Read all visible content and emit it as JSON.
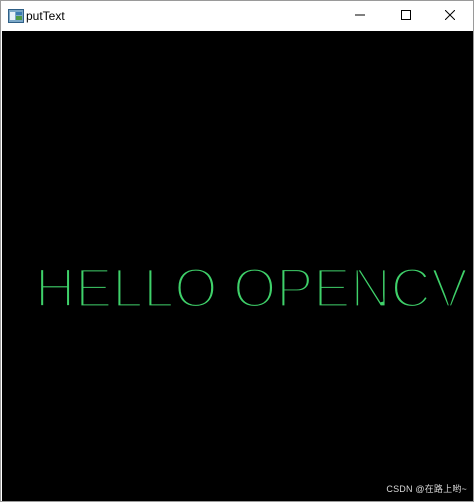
{
  "window": {
    "title": "putText",
    "icon": "app-window-icon",
    "controls": {
      "minimize_icon": "minimize-icon",
      "maximize_icon": "maximize-icon",
      "close_icon": "close-icon"
    }
  },
  "canvas": {
    "background": "#000000",
    "text": "HELLO OPENCV",
    "text_color": "#3fd16a"
  },
  "watermark": {
    "text": "CSDN @在路上哟~"
  }
}
